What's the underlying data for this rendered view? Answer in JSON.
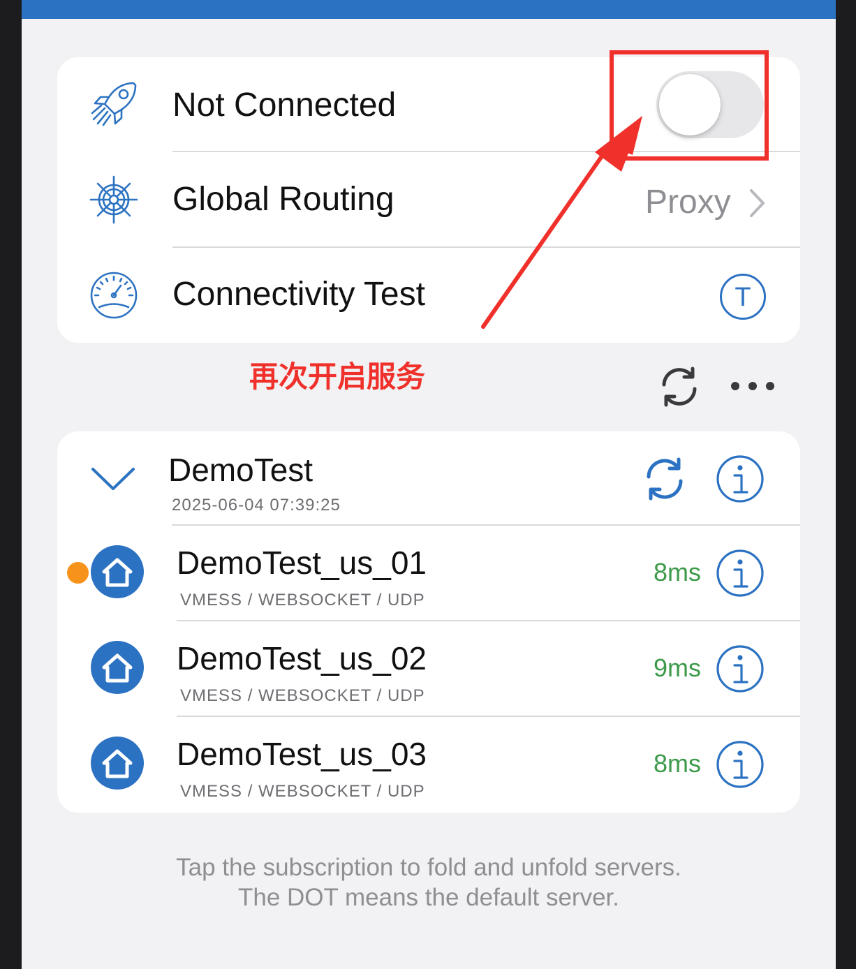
{
  "status_card": {
    "connection_label": "Not Connected",
    "connection_toggle_on": false,
    "routing_label": "Global Routing",
    "routing_value": "Proxy",
    "connectivity_label": "Connectivity Test",
    "connectivity_button_glyph": "T"
  },
  "annotation": {
    "text": "再次开启服务",
    "color": "#f0302a"
  },
  "subscription": {
    "name": "DemoTest",
    "updated": "2025-06-04 07:39:25",
    "servers": [
      {
        "name": "DemoTest_us_01",
        "protocol": "VMESS / WEBSOCKET / UDP",
        "latency": "8ms",
        "is_default": true
      },
      {
        "name": "DemoTest_us_02",
        "protocol": "VMESS / WEBSOCKET / UDP",
        "latency": "9ms",
        "is_default": false
      },
      {
        "name": "DemoTest_us_03",
        "protocol": "VMESS / WEBSOCKET / UDP",
        "latency": "8ms",
        "is_default": false
      }
    ]
  },
  "footer": {
    "line1": "Tap the subscription to fold and unfold servers.",
    "line2": "The DOT means the default server."
  },
  "colors": {
    "accent": "#2c72c2",
    "latency_good": "#3c9a4a",
    "default_dot": "#f7931a",
    "callout": "#f0302a"
  },
  "icons": {
    "connection": "rocket-icon",
    "routing": "ship-wheel-icon",
    "connectivity": "speedometer-icon",
    "server": "home-icon"
  }
}
